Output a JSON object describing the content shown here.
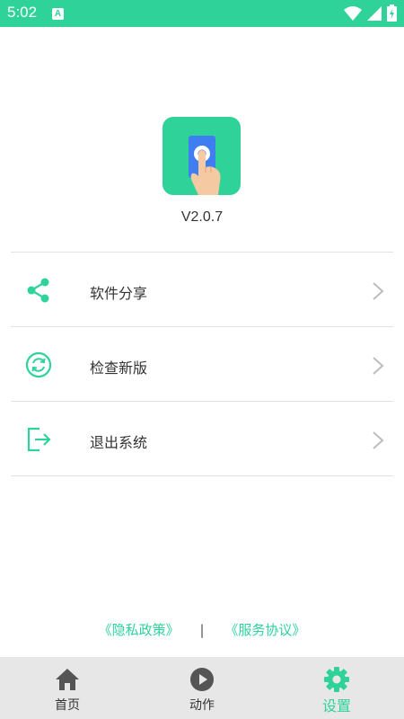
{
  "status_bar": {
    "time": "5:02",
    "notification_badge": "A",
    "icons": [
      "wifi-icon",
      "signal-icon",
      "battery-charging-icon"
    ]
  },
  "app": {
    "logo_icon": "hand-tap-phone-icon",
    "version": "V2.0.7"
  },
  "menu": {
    "items": [
      {
        "icon": "share-icon",
        "label": "软件分享"
      },
      {
        "icon": "refresh-icon",
        "label": "检查新版"
      },
      {
        "icon": "exit-icon",
        "label": "退出系统"
      }
    ]
  },
  "footer_links": {
    "privacy": "《隐私政策》",
    "separator": "|",
    "service": "《服务协议》"
  },
  "tabbar": {
    "tabs": [
      {
        "icon": "home-icon",
        "label": "首页",
        "active": false
      },
      {
        "icon": "play-icon",
        "label": "动作",
        "active": false
      },
      {
        "icon": "gear-icon",
        "label": "设置",
        "active": true
      }
    ]
  },
  "colors": {
    "accent": "#2fd39a",
    "tabbar_bg": "#e7e7e7",
    "divider": "#e3e3e3",
    "icon_dark": "#555555"
  }
}
